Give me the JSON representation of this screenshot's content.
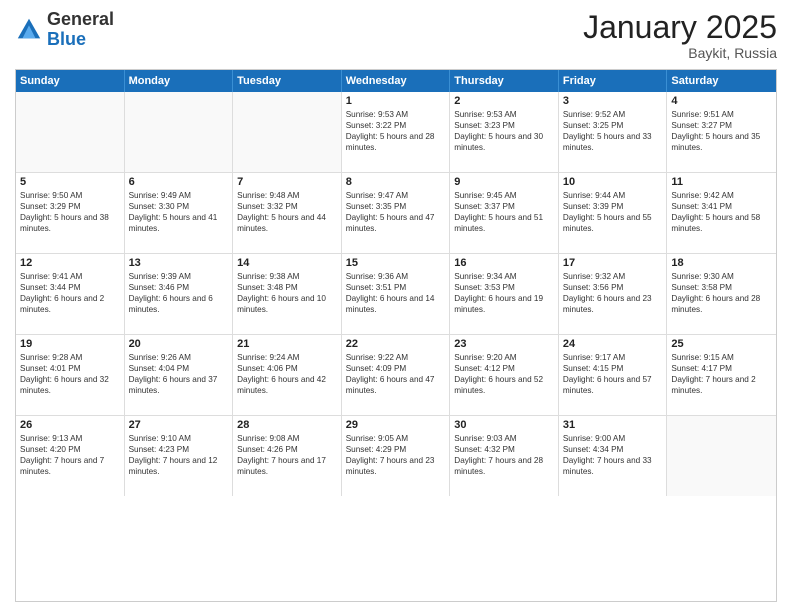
{
  "header": {
    "logo_general": "General",
    "logo_blue": "Blue",
    "month_year": "January 2025",
    "location": "Baykit, Russia"
  },
  "weekdays": [
    "Sunday",
    "Monday",
    "Tuesday",
    "Wednesday",
    "Thursday",
    "Friday",
    "Saturday"
  ],
  "weeks": [
    [
      {
        "day": "",
        "empty": true
      },
      {
        "day": "",
        "empty": true
      },
      {
        "day": "",
        "empty": true
      },
      {
        "day": "1",
        "sunrise": "Sunrise: 9:53 AM",
        "sunset": "Sunset: 3:22 PM",
        "daylight": "Daylight: 5 hours and 28 minutes."
      },
      {
        "day": "2",
        "sunrise": "Sunrise: 9:53 AM",
        "sunset": "Sunset: 3:23 PM",
        "daylight": "Daylight: 5 hours and 30 minutes."
      },
      {
        "day": "3",
        "sunrise": "Sunrise: 9:52 AM",
        "sunset": "Sunset: 3:25 PM",
        "daylight": "Daylight: 5 hours and 33 minutes."
      },
      {
        "day": "4",
        "sunrise": "Sunrise: 9:51 AM",
        "sunset": "Sunset: 3:27 PM",
        "daylight": "Daylight: 5 hours and 35 minutes."
      }
    ],
    [
      {
        "day": "5",
        "sunrise": "Sunrise: 9:50 AM",
        "sunset": "Sunset: 3:29 PM",
        "daylight": "Daylight: 5 hours and 38 minutes."
      },
      {
        "day": "6",
        "sunrise": "Sunrise: 9:49 AM",
        "sunset": "Sunset: 3:30 PM",
        "daylight": "Daylight: 5 hours and 41 minutes."
      },
      {
        "day": "7",
        "sunrise": "Sunrise: 9:48 AM",
        "sunset": "Sunset: 3:32 PM",
        "daylight": "Daylight: 5 hours and 44 minutes."
      },
      {
        "day": "8",
        "sunrise": "Sunrise: 9:47 AM",
        "sunset": "Sunset: 3:35 PM",
        "daylight": "Daylight: 5 hours and 47 minutes."
      },
      {
        "day": "9",
        "sunrise": "Sunrise: 9:45 AM",
        "sunset": "Sunset: 3:37 PM",
        "daylight": "Daylight: 5 hours and 51 minutes."
      },
      {
        "day": "10",
        "sunrise": "Sunrise: 9:44 AM",
        "sunset": "Sunset: 3:39 PM",
        "daylight": "Daylight: 5 hours and 55 minutes."
      },
      {
        "day": "11",
        "sunrise": "Sunrise: 9:42 AM",
        "sunset": "Sunset: 3:41 PM",
        "daylight": "Daylight: 5 hours and 58 minutes."
      }
    ],
    [
      {
        "day": "12",
        "sunrise": "Sunrise: 9:41 AM",
        "sunset": "Sunset: 3:44 PM",
        "daylight": "Daylight: 6 hours and 2 minutes."
      },
      {
        "day": "13",
        "sunrise": "Sunrise: 9:39 AM",
        "sunset": "Sunset: 3:46 PM",
        "daylight": "Daylight: 6 hours and 6 minutes."
      },
      {
        "day": "14",
        "sunrise": "Sunrise: 9:38 AM",
        "sunset": "Sunset: 3:48 PM",
        "daylight": "Daylight: 6 hours and 10 minutes."
      },
      {
        "day": "15",
        "sunrise": "Sunrise: 9:36 AM",
        "sunset": "Sunset: 3:51 PM",
        "daylight": "Daylight: 6 hours and 14 minutes."
      },
      {
        "day": "16",
        "sunrise": "Sunrise: 9:34 AM",
        "sunset": "Sunset: 3:53 PM",
        "daylight": "Daylight: 6 hours and 19 minutes."
      },
      {
        "day": "17",
        "sunrise": "Sunrise: 9:32 AM",
        "sunset": "Sunset: 3:56 PM",
        "daylight": "Daylight: 6 hours and 23 minutes."
      },
      {
        "day": "18",
        "sunrise": "Sunrise: 9:30 AM",
        "sunset": "Sunset: 3:58 PM",
        "daylight": "Daylight: 6 hours and 28 minutes."
      }
    ],
    [
      {
        "day": "19",
        "sunrise": "Sunrise: 9:28 AM",
        "sunset": "Sunset: 4:01 PM",
        "daylight": "Daylight: 6 hours and 32 minutes."
      },
      {
        "day": "20",
        "sunrise": "Sunrise: 9:26 AM",
        "sunset": "Sunset: 4:04 PM",
        "daylight": "Daylight: 6 hours and 37 minutes."
      },
      {
        "day": "21",
        "sunrise": "Sunrise: 9:24 AM",
        "sunset": "Sunset: 4:06 PM",
        "daylight": "Daylight: 6 hours and 42 minutes."
      },
      {
        "day": "22",
        "sunrise": "Sunrise: 9:22 AM",
        "sunset": "Sunset: 4:09 PM",
        "daylight": "Daylight: 6 hours and 47 minutes."
      },
      {
        "day": "23",
        "sunrise": "Sunrise: 9:20 AM",
        "sunset": "Sunset: 4:12 PM",
        "daylight": "Daylight: 6 hours and 52 minutes."
      },
      {
        "day": "24",
        "sunrise": "Sunrise: 9:17 AM",
        "sunset": "Sunset: 4:15 PM",
        "daylight": "Daylight: 6 hours and 57 minutes."
      },
      {
        "day": "25",
        "sunrise": "Sunrise: 9:15 AM",
        "sunset": "Sunset: 4:17 PM",
        "daylight": "Daylight: 7 hours and 2 minutes."
      }
    ],
    [
      {
        "day": "26",
        "sunrise": "Sunrise: 9:13 AM",
        "sunset": "Sunset: 4:20 PM",
        "daylight": "Daylight: 7 hours and 7 minutes."
      },
      {
        "day": "27",
        "sunrise": "Sunrise: 9:10 AM",
        "sunset": "Sunset: 4:23 PM",
        "daylight": "Daylight: 7 hours and 12 minutes."
      },
      {
        "day": "28",
        "sunrise": "Sunrise: 9:08 AM",
        "sunset": "Sunset: 4:26 PM",
        "daylight": "Daylight: 7 hours and 17 minutes."
      },
      {
        "day": "29",
        "sunrise": "Sunrise: 9:05 AM",
        "sunset": "Sunset: 4:29 PM",
        "daylight": "Daylight: 7 hours and 23 minutes."
      },
      {
        "day": "30",
        "sunrise": "Sunrise: 9:03 AM",
        "sunset": "Sunset: 4:32 PM",
        "daylight": "Daylight: 7 hours and 28 minutes."
      },
      {
        "day": "31",
        "sunrise": "Sunrise: 9:00 AM",
        "sunset": "Sunset: 4:34 PM",
        "daylight": "Daylight: 7 hours and 33 minutes."
      },
      {
        "day": "",
        "empty": true
      }
    ]
  ]
}
